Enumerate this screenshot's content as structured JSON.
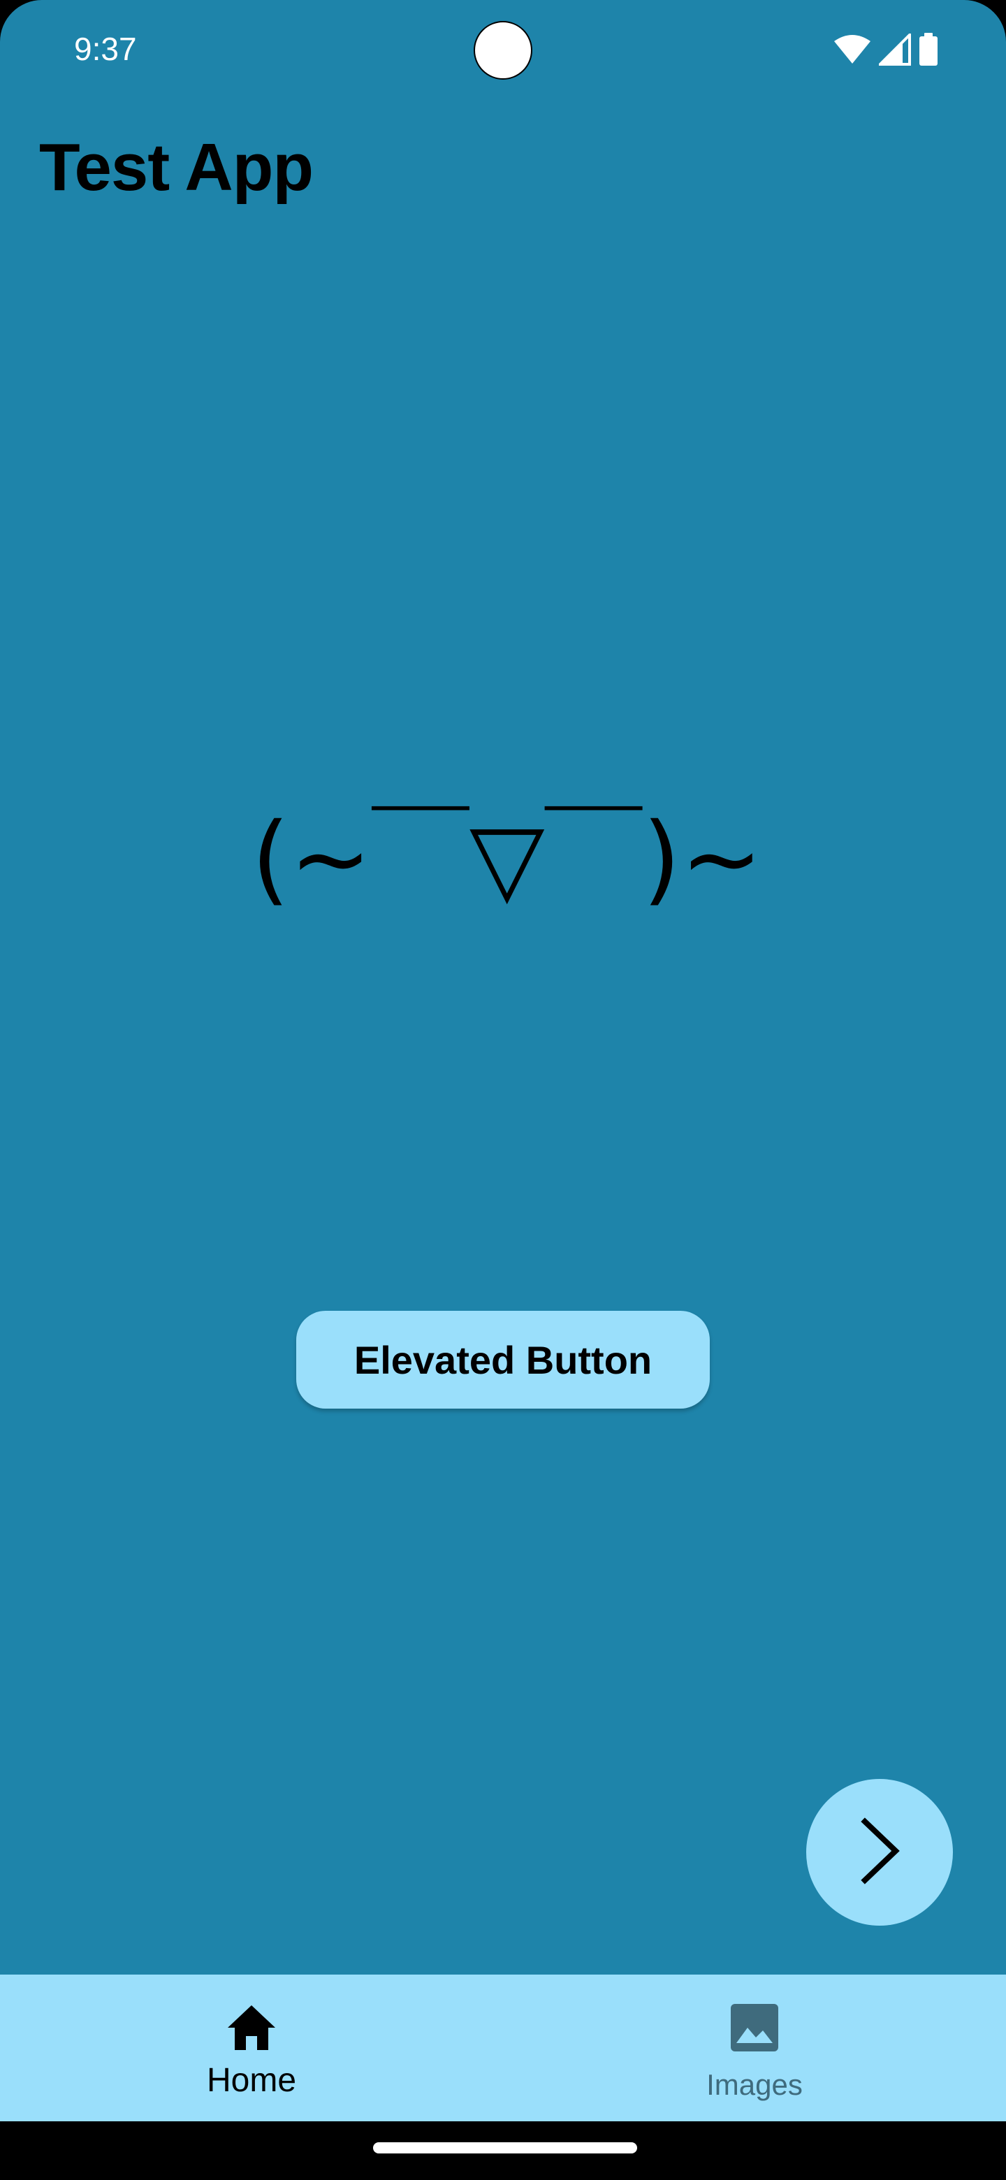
{
  "status_bar": {
    "time": "9:37",
    "icons": [
      "wifi-icon",
      "cellular-signal-icon",
      "battery-icon"
    ]
  },
  "app": {
    "title": "Test App",
    "background_color": "#1E84AA",
    "accent_color": "#9ADFFB"
  },
  "content": {
    "kaomoji": "(~￣▽￣)~",
    "elevated_button_label": "Elevated Button"
  },
  "fab": {
    "icon": "chevron-right-icon"
  },
  "bottom_nav": {
    "items": [
      {
        "label": "Home",
        "icon": "home-icon",
        "selected": true
      },
      {
        "label": "Images",
        "icon": "image-icon",
        "selected": false
      }
    ]
  }
}
